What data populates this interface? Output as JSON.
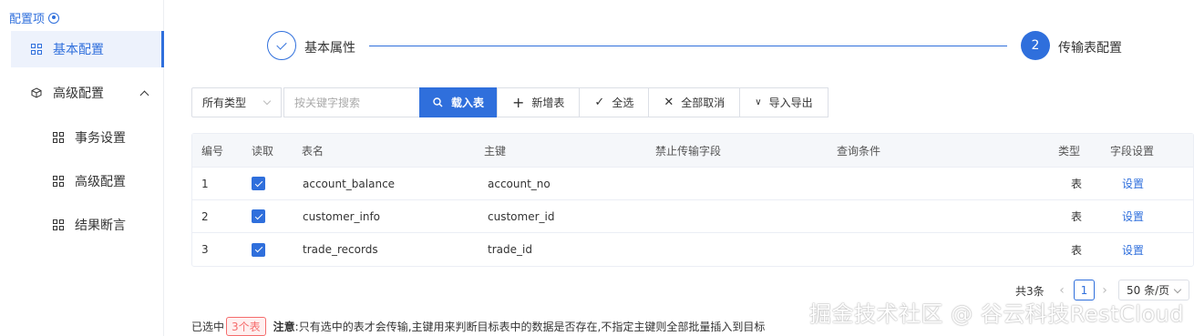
{
  "sidebar": {
    "title": "配置项",
    "items": [
      {
        "label": "基本配置"
      },
      {
        "label": "高级配置"
      },
      {
        "label": "事务设置"
      },
      {
        "label": "高级配置"
      },
      {
        "label": "结果断言"
      }
    ]
  },
  "steps": [
    {
      "label": "基本属性",
      "state": "done"
    },
    {
      "number": "2",
      "label": "传输表配置",
      "state": "active"
    }
  ],
  "toolbar": {
    "type_select": "所有类型",
    "search_placeholder": "按关键字搜索",
    "load_label": "载入表",
    "add_label": "新增表",
    "select_all_label": "全选",
    "cancel_all_label": "全部取消",
    "import_export_label": "导入导出"
  },
  "table": {
    "headers": [
      "编号",
      "读取",
      "表名",
      "主键",
      "禁止传输字段",
      "查询条件",
      "类型",
      "字段设置"
    ],
    "rows": [
      {
        "no": "1",
        "checked": true,
        "name": "account_balance",
        "pk": "account_no",
        "forbid": "",
        "cond": "",
        "type": "表",
        "action": "设置"
      },
      {
        "no": "2",
        "checked": true,
        "name": "customer_info",
        "pk": "customer_id",
        "forbid": "",
        "cond": "",
        "type": "表",
        "action": "设置"
      },
      {
        "no": "3",
        "checked": true,
        "name": "trade_records",
        "pk": "trade_id",
        "forbid": "",
        "cond": "",
        "type": "表",
        "action": "设置"
      }
    ]
  },
  "pagination": {
    "total": "共3条",
    "current_page": "1",
    "page_size": "50 条/页"
  },
  "footer": {
    "selected_prefix": "已选中",
    "selected_count": "3个表",
    "note_label": "注意",
    "note_text": ":只有选中的表才会传输,主键用来判断目标表中的数据是否存在,不指定主键则全部批量插入到目标"
  },
  "watermark": "掘金技术社区 @ 谷云科技RestCloud",
  "colors": {
    "accent": "#2f6fdc",
    "danger": "#f56c6c"
  }
}
